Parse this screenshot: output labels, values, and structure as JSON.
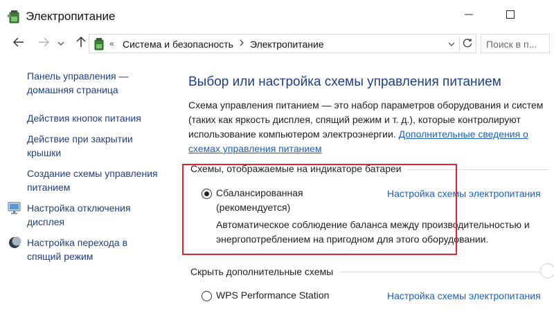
{
  "window": {
    "title": "Электропитание",
    "app_icon": "battery-plug-icon",
    "controls": {
      "minimize": "minimize-icon",
      "maximize": "maximize-icon"
    }
  },
  "address": {
    "breadcrumb": [
      "Система и безопасность",
      "Электропитание"
    ],
    "overflow": "«",
    "search_placeholder": "Поиск в п..."
  },
  "sidebar": {
    "items": [
      {
        "label_1": "Панель управления —",
        "label_2": "домашняя страница",
        "icon": ""
      },
      {
        "label_1": "Действия кнопок питания",
        "label_2": "",
        "icon": ""
      },
      {
        "label_1": "Действие при закрытии",
        "label_2": "крышки",
        "icon": ""
      },
      {
        "label_1": "Создание схемы управления",
        "label_2": "питанием",
        "icon": ""
      },
      {
        "label_1": "Настройка отключения",
        "label_2": "дисплея",
        "icon": "monitor-icon"
      },
      {
        "label_1": "Настройка перехода в",
        "label_2": "спящий режим",
        "icon": "moon-icon"
      }
    ]
  },
  "main": {
    "heading": "Выбор или настройка схемы управления питанием",
    "description": {
      "line1": "Схема управления питанием — это набор параметров оборудования и систем",
      "line2": "(таких как яркость дисплея, спящий режим и т. д.), которые контролируют",
      "line3_text": "использование компьютером электроэнергии. ",
      "line3_link": "Дополнительные сведения о",
      "line4_link": "схемах управления питанием"
    },
    "battery_section": {
      "title": "Схемы, отображаемые на индикаторе батареи",
      "plan": {
        "name_1": "Сбалансированная",
        "name_2": "(рекомендуется)",
        "selected": true,
        "settings_link": "Настройка схемы электропитания",
        "desc_1": "Автоматическое соблюдение баланса между производительностью и",
        "desc_2": "энергопотреблением на пригодном для этого оборудовании."
      }
    },
    "hidden_section": {
      "title": "Скрыть дополнительные схемы",
      "plan": {
        "name": "WPS Performance Station",
        "selected": false,
        "settings_link": "Настройка схемы электропитания"
      }
    }
  },
  "colors": {
    "link": "#1a5fc0",
    "heading": "#1e3f8a",
    "nav_link": "#1f3f80",
    "highlight": "#e2242a"
  }
}
